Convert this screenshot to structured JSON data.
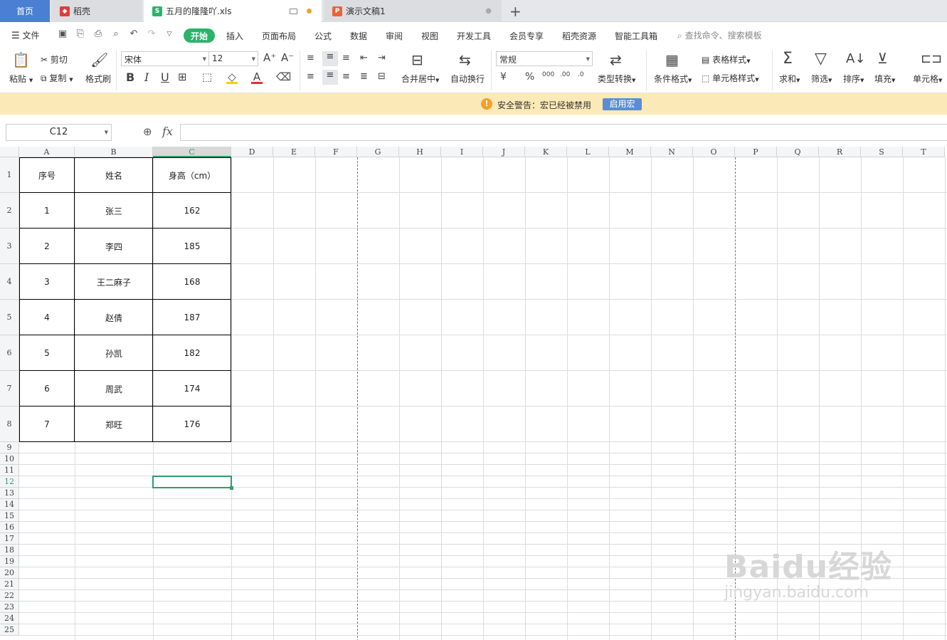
{
  "tabs": {
    "home": "首页",
    "daoke": "稻壳",
    "sheet": "五月的隆隆吖.xls",
    "presentation": "演示文稿1"
  },
  "menu": {
    "file": "文件",
    "start": "开始",
    "items": [
      "插入",
      "页面布局",
      "公式",
      "数据",
      "审阅",
      "视图",
      "开发工具",
      "会员专享",
      "稻壳资源",
      "智能工具箱"
    ],
    "search_placeholder": "查找命令、搜索模板"
  },
  "ribbon": {
    "paste": "粘贴",
    "cut": "剪切",
    "copy": "复制",
    "format_painter": "格式刷",
    "font_name": "宋体",
    "font_size": "12",
    "merge_center": "合并居中",
    "wrap_text": "自动换行",
    "number_format": "常规",
    "type_convert": "类型转换",
    "cond_format": "条件格式",
    "table_style": "表格样式",
    "cell_style": "单元格样式",
    "sum": "求和",
    "filter": "筛选",
    "sort": "排序",
    "fill": "填充",
    "cell": "单元格"
  },
  "warning": {
    "text": "安全警告：宏已经被禁用",
    "button": "启用宏"
  },
  "formula_bar": {
    "cell_ref": "C12",
    "fx": "fx",
    "content": ""
  },
  "columns": [
    "A",
    "B",
    "C",
    "D",
    "E",
    "F",
    "G",
    "H",
    "I",
    "J",
    "K",
    "L",
    "M",
    "N",
    "O",
    "P",
    "Q",
    "R",
    "S",
    "T"
  ],
  "selected_column": "C",
  "selected_row": "12",
  "rows": [
    "1",
    "2",
    "3",
    "4",
    "5",
    "6",
    "7",
    "8",
    "9",
    "10",
    "11",
    "12",
    "13",
    "14",
    "15",
    "16",
    "17",
    "18",
    "19",
    "20",
    "21",
    "22",
    "23",
    "24",
    "25"
  ],
  "table": {
    "headers": [
      "序号",
      "姓名",
      "身高（cm）"
    ],
    "rows": [
      [
        "1",
        "张三",
        "162"
      ],
      [
        "2",
        "李四",
        "185"
      ],
      [
        "3",
        "王二麻子",
        "168"
      ],
      [
        "4",
        "赵倩",
        "187"
      ],
      [
        "5",
        "孙凯",
        "182"
      ],
      [
        "6",
        "周武",
        "174"
      ],
      [
        "7",
        "郑旺",
        "176"
      ]
    ]
  },
  "watermark": {
    "brand": "Baidu经验",
    "url": "jingyan.baidu.com"
  }
}
